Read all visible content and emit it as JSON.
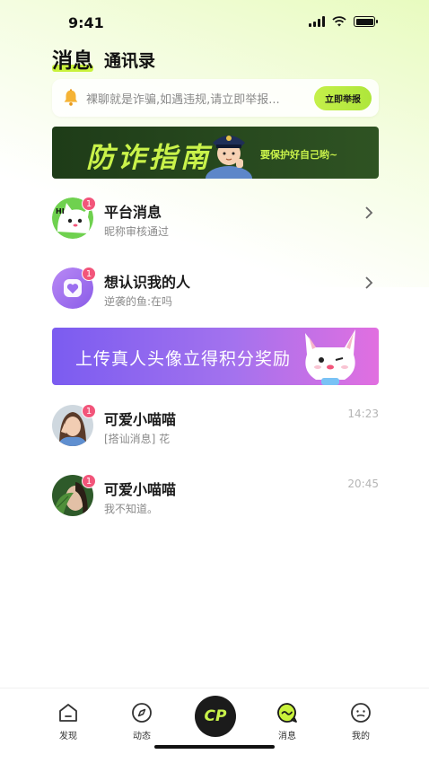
{
  "status_bar": {
    "time": "9:41"
  },
  "tabs": {
    "active": "消息",
    "inactive": "通讯录"
  },
  "notice": {
    "text": "裸聊就是诈骗,如遇违规,请立即举报...",
    "button": "立即举报"
  },
  "banner_fraud": {
    "title": "防诈指南",
    "subtitle": "要保护好自己哟~"
  },
  "list": [
    {
      "title": "平台消息",
      "subtitle": "昵称审核通过",
      "badge": "1"
    },
    {
      "title": "想认识我的人",
      "subtitle": "逆袭的鱼:在吗",
      "badge": "1"
    }
  ],
  "banner_avatar": {
    "text": "上传真人头像立得积分奖励"
  },
  "chats": [
    {
      "name": "可爱小喵喵",
      "message": "[搭讪消息] 花",
      "time": "14:23",
      "badge": "1"
    },
    {
      "name": "可爱小喵喵",
      "message": "我不知道。",
      "time": "20:45",
      "badge": "1"
    }
  ],
  "bottom_nav": {
    "discover": "发现",
    "moments": "动态",
    "center": "CP",
    "messages": "消息",
    "mine": "我的"
  },
  "colors": {
    "accent": "#c9f23b",
    "badge": "#f2557a",
    "banner_purple": "#8b63f0"
  }
}
